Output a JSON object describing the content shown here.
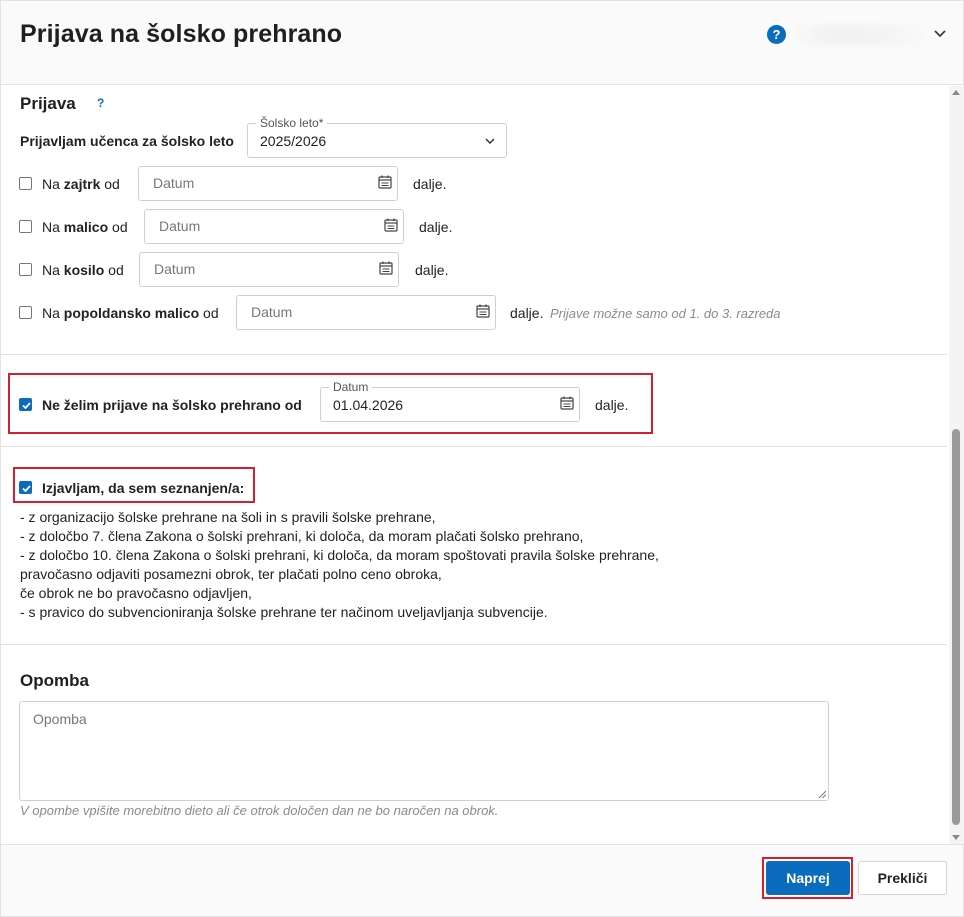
{
  "header": {
    "title": "Prijava na šolsko prehrano",
    "help_symbol": "?"
  },
  "prijava": {
    "title": "Prijava",
    "help_symbol": "?",
    "year_label": "Prijavljam učenca za šolsko leto",
    "year_field_legend": "Šolsko leto*",
    "year_value": "2025/2026",
    "meals": [
      {
        "prefix": "Na",
        "name": "zajtrk",
        "suffix": "od",
        "placeholder": "Datum",
        "after": "dalje."
      },
      {
        "prefix": "Na",
        "name": "malico",
        "suffix": "od",
        "placeholder": "Datum",
        "after": "dalje."
      },
      {
        "prefix": "Na",
        "name": "kosilo",
        "suffix": "od",
        "placeholder": "Datum",
        "after": "dalje."
      },
      {
        "prefix": "Na",
        "name": "popoldansko malico",
        "suffix": "od",
        "placeholder": "Datum",
        "after": "dalje.",
        "note": "Prijave možne samo od 1. do 3. razreda"
      }
    ]
  },
  "optout": {
    "label": "Ne želim prijave na šolsko prehrano od",
    "checked": true,
    "date_legend": "Datum",
    "date_value": "01.04.2026",
    "after": "dalje."
  },
  "declaration": {
    "label": "Izjavljam, da sem seznanjen/a:",
    "checked": true,
    "lines": [
      "- z organizacijo šolske prehrane na šoli in s pravili šolske prehrane,",
      "- z določbo 7. člena Zakona o šolski prehrani, ki določa, da moram plačati šolsko prehrano,",
      "- z določbo 10. člena Zakona o šolski prehrani, ki določa, da moram spoštovati pravila šolske prehrane,",
      "pravočasno odjaviti posamezni obrok, ter plačati polno ceno obroka,",
      "če obrok ne bo pravočasno odjavljen,",
      "- s pravico do subvencioniranja šolske prehrane ter načinom uveljavljanja subvencije."
    ]
  },
  "note": {
    "title": "Opomba",
    "placeholder": "Opomba",
    "hint": "V opombe vpišite morebitno dieto ali če otrok določen dan ne bo naročen na obrok."
  },
  "footer": {
    "primary_label": "Naprej",
    "secondary_label": "Prekliči"
  },
  "colors": {
    "primary": "#0b6bbd",
    "highlight": "#d32030"
  }
}
